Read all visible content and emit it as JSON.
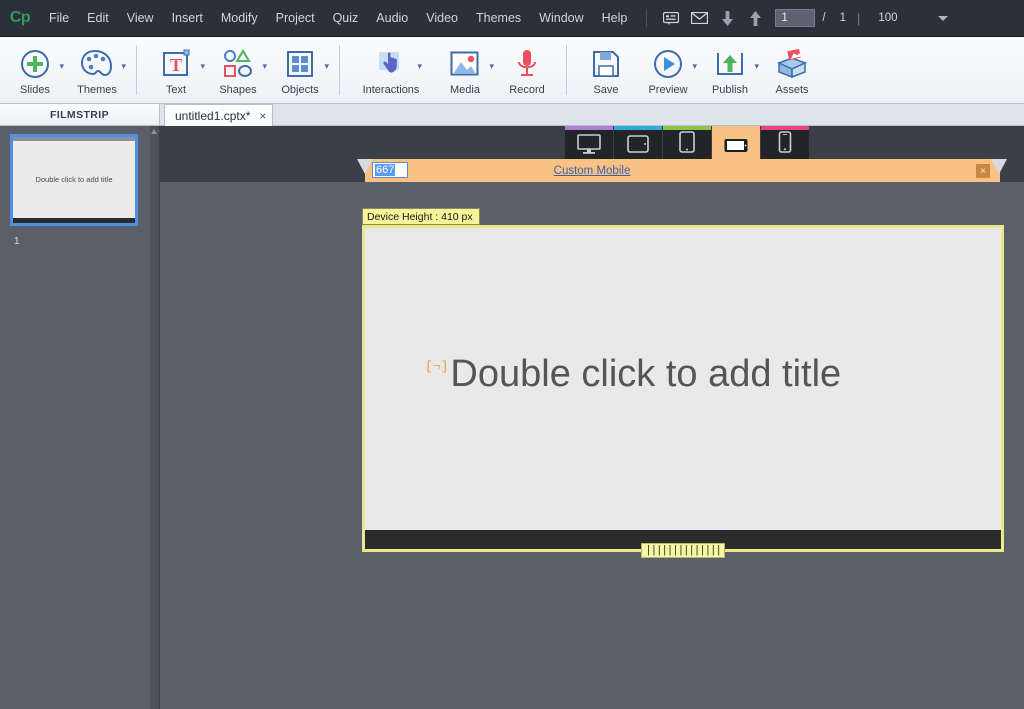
{
  "app": {
    "logo": "Cp"
  },
  "menubar": {
    "items": [
      "File",
      "Edit",
      "View",
      "Insert",
      "Modify",
      "Project",
      "Quiz",
      "Audio",
      "Video",
      "Themes",
      "Window",
      "Help"
    ],
    "icons": [
      "comment-icon",
      "envelope-icon",
      "arrow-down-icon",
      "arrow-up-icon"
    ],
    "current_slide": "1",
    "slide_separator": "/",
    "total_slides": "1",
    "divider": "|",
    "zoom_level": "100"
  },
  "toolbar": {
    "groups": [
      {
        "tools": [
          {
            "label": "Slides",
            "icon": "plus-circle-icon",
            "caret": true
          },
          {
            "label": "Themes",
            "icon": "palette-icon",
            "caret": true
          }
        ]
      },
      {
        "tools": [
          {
            "label": "Text",
            "icon": "text-box-icon",
            "caret": true
          },
          {
            "label": "Shapes",
            "icon": "shapes-icon",
            "caret": true
          },
          {
            "label": "Objects",
            "icon": "objects-grid-icon",
            "caret": true
          }
        ]
      },
      {
        "tools": [
          {
            "label": "Interactions",
            "icon": "hand-pointer-icon",
            "caret": true
          },
          {
            "label": "Media",
            "icon": "image-icon",
            "caret": true
          },
          {
            "label": "Record",
            "icon": "microphone-icon",
            "caret": false
          }
        ]
      },
      {
        "tools": [
          {
            "label": "Save",
            "icon": "floppy-disk-icon",
            "caret": false
          },
          {
            "label": "Preview",
            "icon": "play-circle-icon",
            "caret": true
          },
          {
            "label": "Publish",
            "icon": "upload-box-icon",
            "caret": true
          },
          {
            "label": "Assets",
            "icon": "assets-box-icon",
            "caret": false
          }
        ]
      }
    ]
  },
  "filmstrip": {
    "header": "FILMSTRIP",
    "slides": [
      {
        "number": "1",
        "title": "Double click to add title"
      }
    ]
  },
  "document_tab": {
    "name": "untitled1.cptx*",
    "close": "×"
  },
  "breakpoints": {
    "devices": [
      {
        "name": "desktop-icon",
        "color": "#b07fd4",
        "selected": false
      },
      {
        "name": "tablet-landscape-icon",
        "color": "#2eaadc",
        "selected": false
      },
      {
        "name": "tablet-portrait-icon",
        "color": "#8cc63f",
        "selected": false
      },
      {
        "name": "mobile-landscape-icon",
        "color": "#f9c183",
        "selected": true
      },
      {
        "name": "mobile-portrait-icon",
        "color": "#e8467c",
        "selected": false
      }
    ],
    "width_value": "667",
    "label": "Custom Mobile",
    "close": "×"
  },
  "stage": {
    "device_height_label": "Device Height : 410 px",
    "title_placeholder": "Double click to add title",
    "placeholder_marker": "[¬]",
    "drag_grip": "||||||||||||||"
  }
}
